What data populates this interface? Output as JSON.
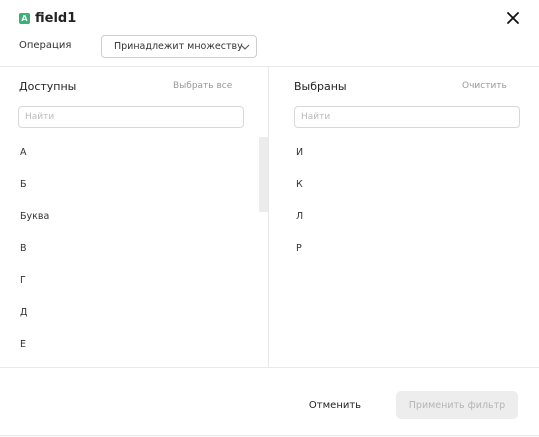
{
  "dialog": {
    "field_badge": "A",
    "title": "field1",
    "close_icon": "close-icon"
  },
  "operation": {
    "label": "Операция",
    "selected": "Принадлежит множеству"
  },
  "available": {
    "title": "Доступны",
    "select_all_label": "Выбрать все",
    "search_placeholder": "Найти",
    "items": [
      "А",
      "Б",
      "Буква",
      "В",
      "Г",
      "Д",
      "Е"
    ]
  },
  "selected": {
    "title": "Выбраны",
    "clear_label": "Очистить",
    "search_placeholder": "Найти",
    "items": [
      "И",
      "К",
      "Л",
      "Р"
    ]
  },
  "footer": {
    "cancel_label": "Отменить",
    "apply_label": "Применить фильтр"
  },
  "colors": {
    "badge_green": "#3bb273",
    "apply_disabled_bg": "#ededed"
  }
}
